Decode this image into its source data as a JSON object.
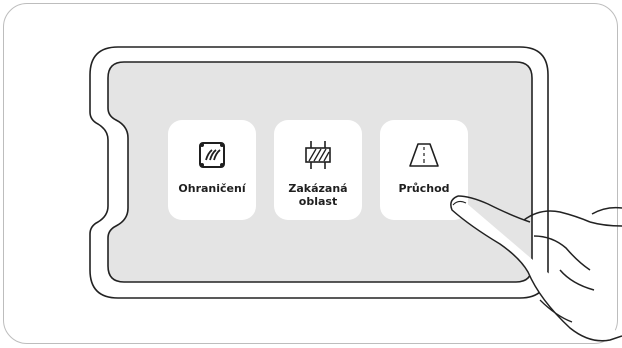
{
  "tiles": [
    {
      "label": "Ohraničení",
      "icon": "boundary-icon"
    },
    {
      "label": "Zakázaná\noblast",
      "icon": "no-go-zone-icon"
    },
    {
      "label": "Průchod",
      "icon": "passage-icon"
    }
  ],
  "colors": {
    "screen_fill": "#e4e4e4",
    "outline": "#222222",
    "frame": "#bdbdbd",
    "tile": "#ffffff"
  }
}
